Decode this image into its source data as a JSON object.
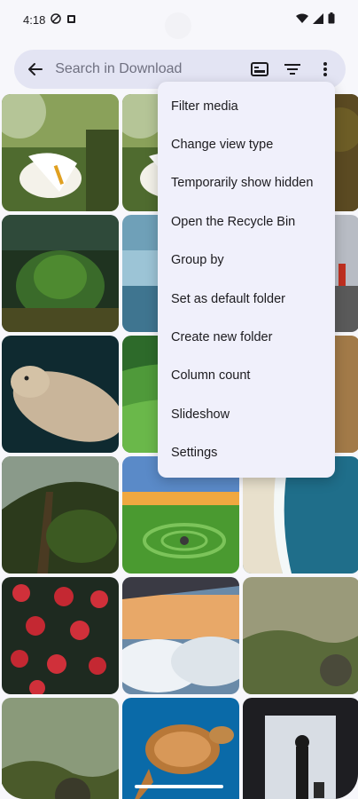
{
  "status_bar": {
    "time": "4:18"
  },
  "search": {
    "placeholder": "Search in Download"
  },
  "menu": {
    "items": [
      "Filter media",
      "Change view type",
      "Temporarily show hidden",
      "Open the Recycle Bin",
      "Group by",
      "Set as default folder",
      "Create new folder",
      "Column count",
      "Slideshow",
      "Settings"
    ]
  },
  "gallery": {
    "thumbnails": [
      "calla-lily",
      "calla-lily",
      "dark-forest",
      "moss-forest",
      "misty-lake",
      "hiker-on-rocks",
      "seal",
      "green-valley",
      "sand-dune",
      "jungle-tree",
      "field-spiral",
      "ocean-shore",
      "red-flowers",
      "sky-clouds",
      "mountain-valley",
      "misty-hills",
      "sea-turtle",
      "traveler-window"
    ]
  },
  "colors": {
    "menu_bg": "#f0f0fb",
    "search_bg": "#e3e4f3",
    "accent": "#1c1b1f"
  }
}
